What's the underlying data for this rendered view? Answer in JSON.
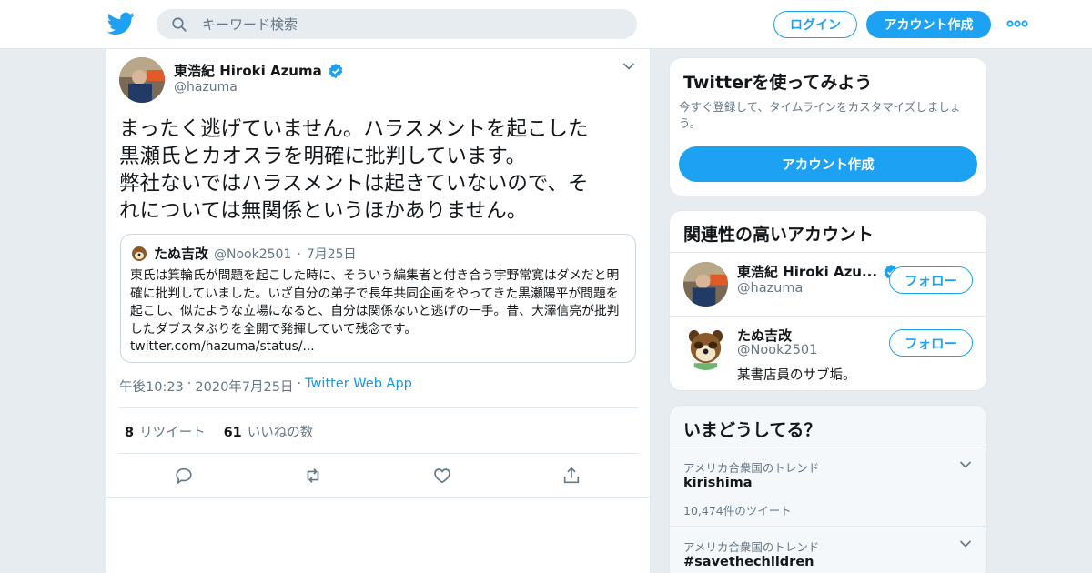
{
  "nav": {
    "search_placeholder": "キーワード検索",
    "login_label": "ログイン",
    "signup_label": "アカウント作成"
  },
  "tweet": {
    "author_name": "東浩紀 Hiroki Azuma",
    "author_handle": "@hazuma",
    "text": "まったく逃げていません。ハラスメントを起こした\n黒瀬氏とカオスラを明確に批判しています。\n弊社ないではハラスメントは起きていないので、そ\nれについては無関係というほかありません。",
    "time": "午後10:23",
    "date": "2020年7月25日",
    "app": "Twitter Web App",
    "retweet_count": "8",
    "retweet_label": "リツイート",
    "like_count": "61",
    "like_label": "いいねの数"
  },
  "quote": {
    "author_name": "たぬ吉改",
    "author_handle": "@Nook2501",
    "date": "7月25日",
    "text": "東氏は箕輪氏が問題を起こした時に、そういう編集者と付き合う宇野常寛はダメだと明確に批判していました。いざ自分の弟子で長年共同企画をやってきた黒瀬陽平が問題を起こし、似たような立場になると、自分は関係ないと逃げの一手。昔、大澤信亮が批判したダブスタぶりを全開で発揮していて残念です。",
    "link": "twitter.com/hazuma/status/..."
  },
  "signup_card": {
    "title": "Twitterを使ってみよう",
    "subtitle": "今すぐ登録して、タイムラインをカスタマイズしましょう。",
    "button_label": "アカウント作成"
  },
  "related": {
    "title": "関連性の高いアカウント",
    "accounts": [
      {
        "name": "東浩紀 Hiroki Azu...",
        "handle": "@hazuma",
        "bio": "",
        "follow_label": "フォロー"
      },
      {
        "name": "たぬ吉改",
        "handle": "@Nook2501",
        "bio": "某書店員のサブ垢。",
        "follow_label": "フォロー"
      }
    ]
  },
  "trends": {
    "title": "いまどうしてる？",
    "items": [
      {
        "location": "アメリカ合衆国のトレンド",
        "name": "kirishima",
        "count": "10,474件のツイート"
      },
      {
        "location": "アメリカ合衆国のトレンド",
        "name": "#savethechildren",
        "count": ""
      }
    ]
  },
  "colors": {
    "brand_blue": "#1da1f2",
    "link_blue": "#1b95e0",
    "secondary_text": "#657786",
    "background": "#e6ecf0",
    "verified": "#1da1f2"
  },
  "icons": [
    "twitter-bird-icon",
    "search-icon",
    "more-dots-icon",
    "verified-icon",
    "chevron-down-icon",
    "reply-icon",
    "retweet-icon",
    "like-icon",
    "share-icon"
  ]
}
